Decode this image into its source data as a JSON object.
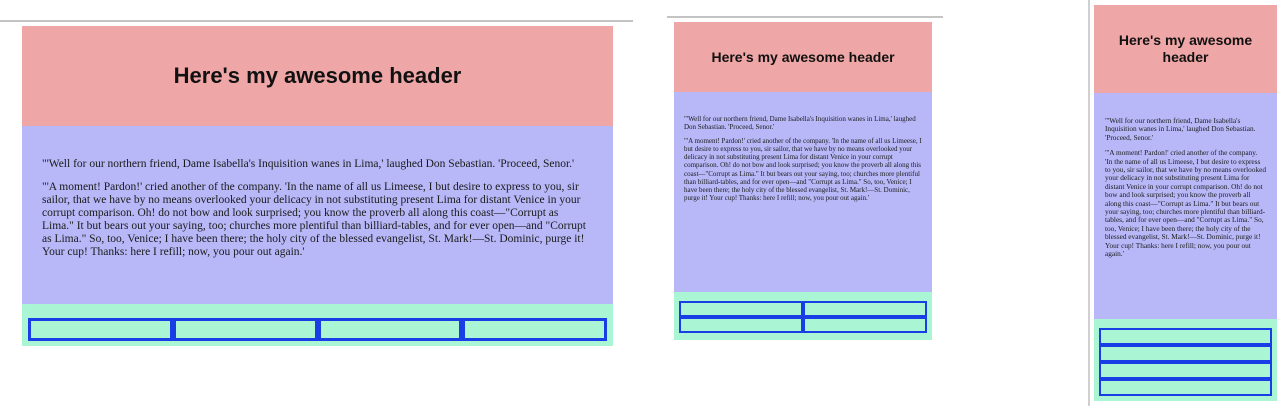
{
  "header": {
    "title": "Here's my awesome header"
  },
  "content": {
    "paragraph_1": "\"'Well for our northern friend, Dame Isabella's Inquisition wanes in Lima,' laughed Don Sebastian. 'Proceed, Senor.'",
    "paragraph_2": "\"'A moment! Pardon!' cried another of the company. 'In the name of all us Limeese, I but desire to express to you, sir sailor, that we have by no means overlooked your delicacy in not substituting present Lima for distant Venice in your corrupt comparison. Oh! do not bow and look surprised; you know the proverb all along this coast—\"Corrupt as Lima.\" It but bears out your saying, too; churches more plentiful than billiard-tables, and for ever open—and \"Corrupt as Lima.\" So, too, Venice; I have been there; the holy city of the blessed evangelist, St. Mark!—St. Dominic, purge it! Your cup! Thanks: here I refill; now, you pour out again.'"
  },
  "colors": {
    "header_bg": "#efa6a6",
    "content_bg": "#b8b8f8",
    "footer_bg": "#aaf5d4",
    "cell_border": "#1a3ee6"
  },
  "layouts": [
    {
      "name": "wide",
      "footer_columns": 4,
      "footer_cells": 4
    },
    {
      "name": "medium",
      "footer_columns": 2,
      "footer_cells": 4
    },
    {
      "name": "narrow",
      "footer_columns": 1,
      "footer_cells": 4
    }
  ]
}
